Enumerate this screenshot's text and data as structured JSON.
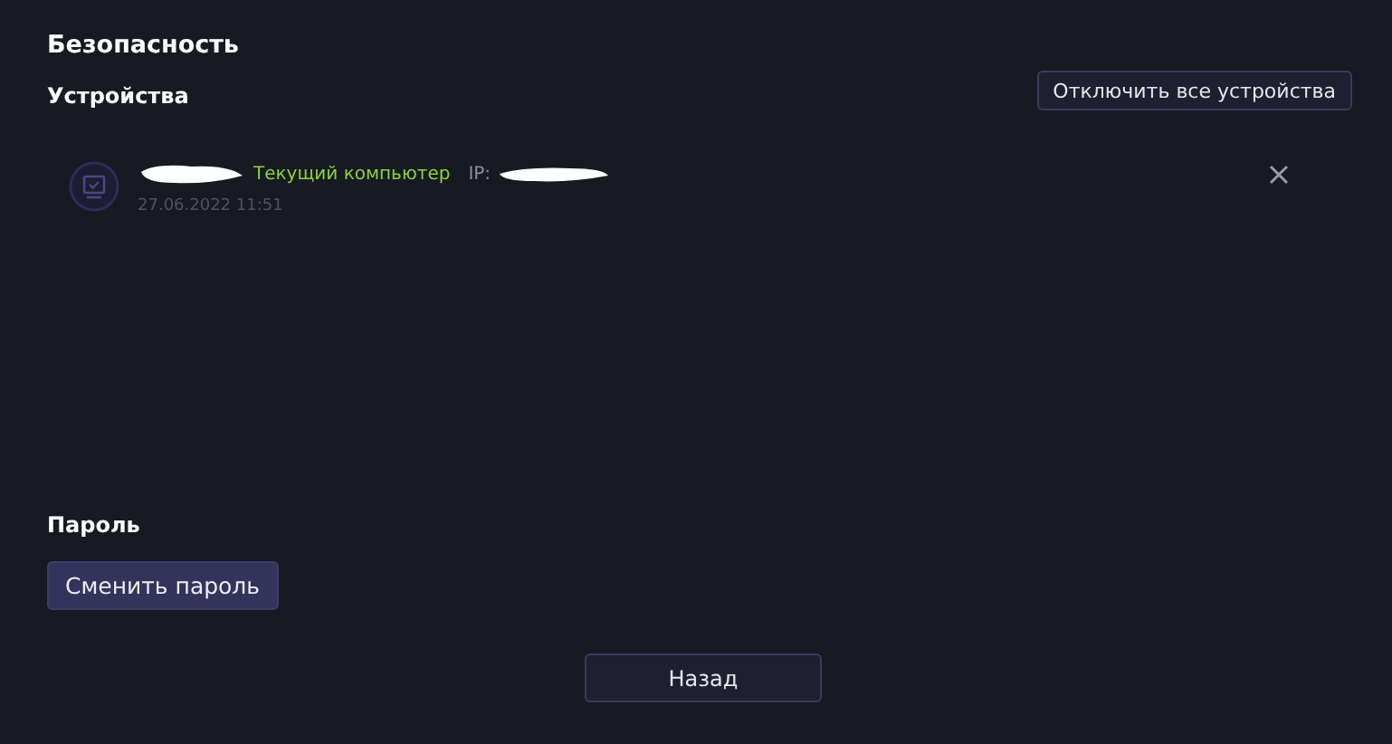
{
  "title": "Безопасность",
  "devices": {
    "heading": "Устройства",
    "disconnect_all": "Отключить все устройства",
    "items": [
      {
        "status": "Текущий компьютер",
        "ip_label": "IP:",
        "date": "27.06.2022 11:51"
      }
    ]
  },
  "password": {
    "heading": "Пароль",
    "button": "Сменить пароль"
  },
  "back": "Назад"
}
